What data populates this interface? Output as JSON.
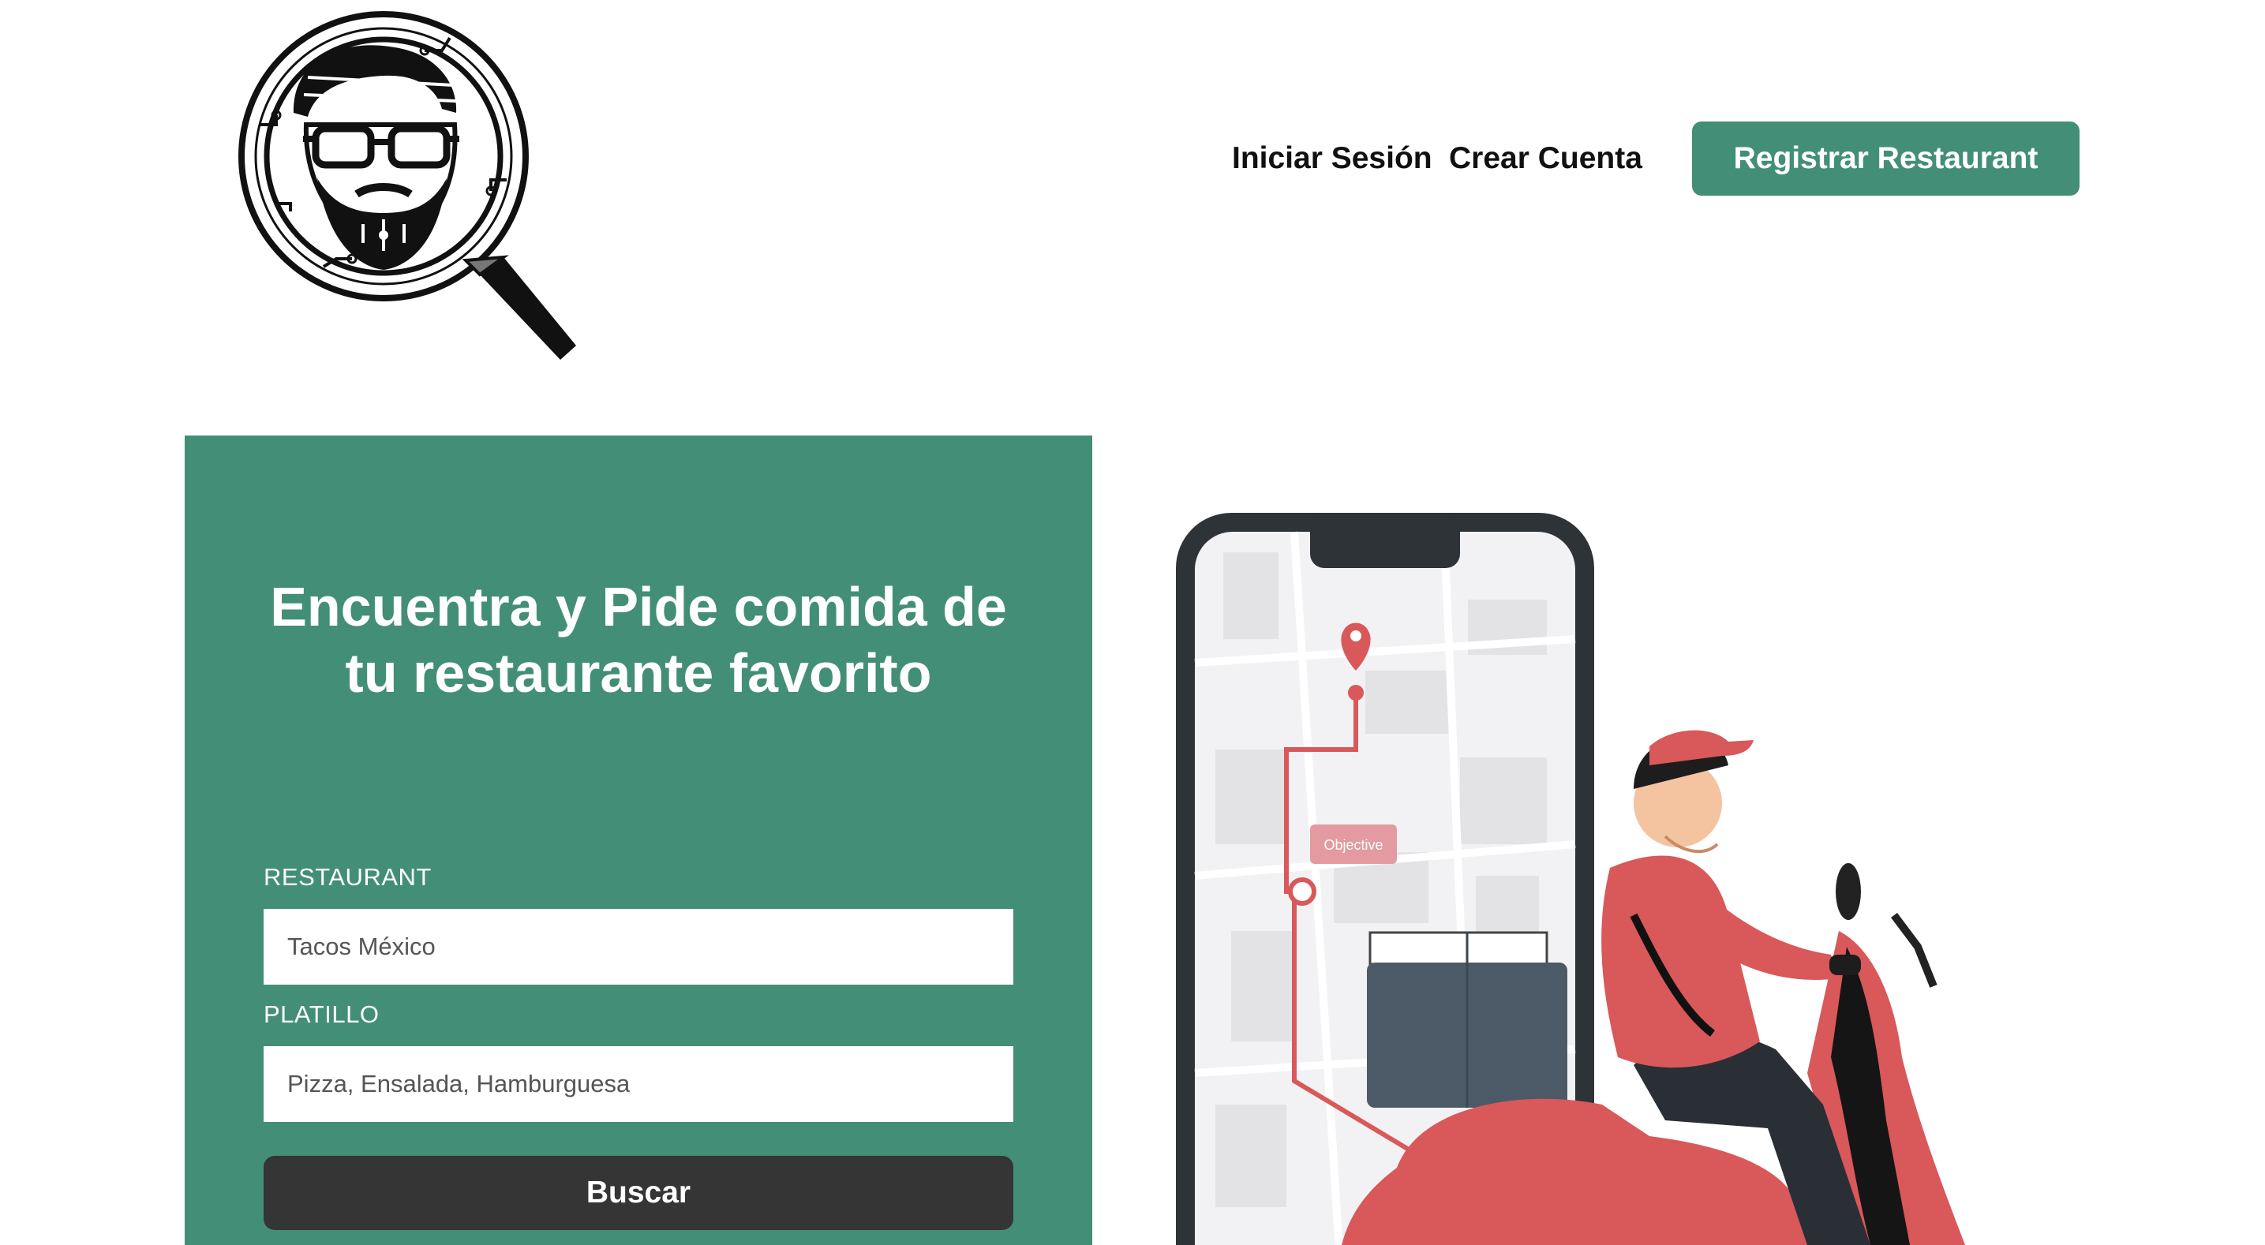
{
  "header": {
    "nav": {
      "login": "Iniciar Sesión",
      "signup": "Crear Cuenta",
      "register_restaurant": "Registrar Restaurant"
    }
  },
  "hero": {
    "title_line1": "Encuentra y Pide comida de",
    "title_line2": "tu restaurante favorito",
    "restaurant_label": "RESTAURANT",
    "restaurant_placeholder": "Tacos México",
    "dish_label": "PLATILLO",
    "dish_placeholder": "Pizza, Ensalada, Hamburguesa",
    "search_button": "Buscar"
  },
  "illustration": {
    "map_tag": "Objective"
  },
  "colors": {
    "brand_green": "#438e77",
    "button_dark": "#353535",
    "accent_red": "#d9585a"
  },
  "icons": [
    "logo-magnifier-icon",
    "map-pin-icon"
  ]
}
